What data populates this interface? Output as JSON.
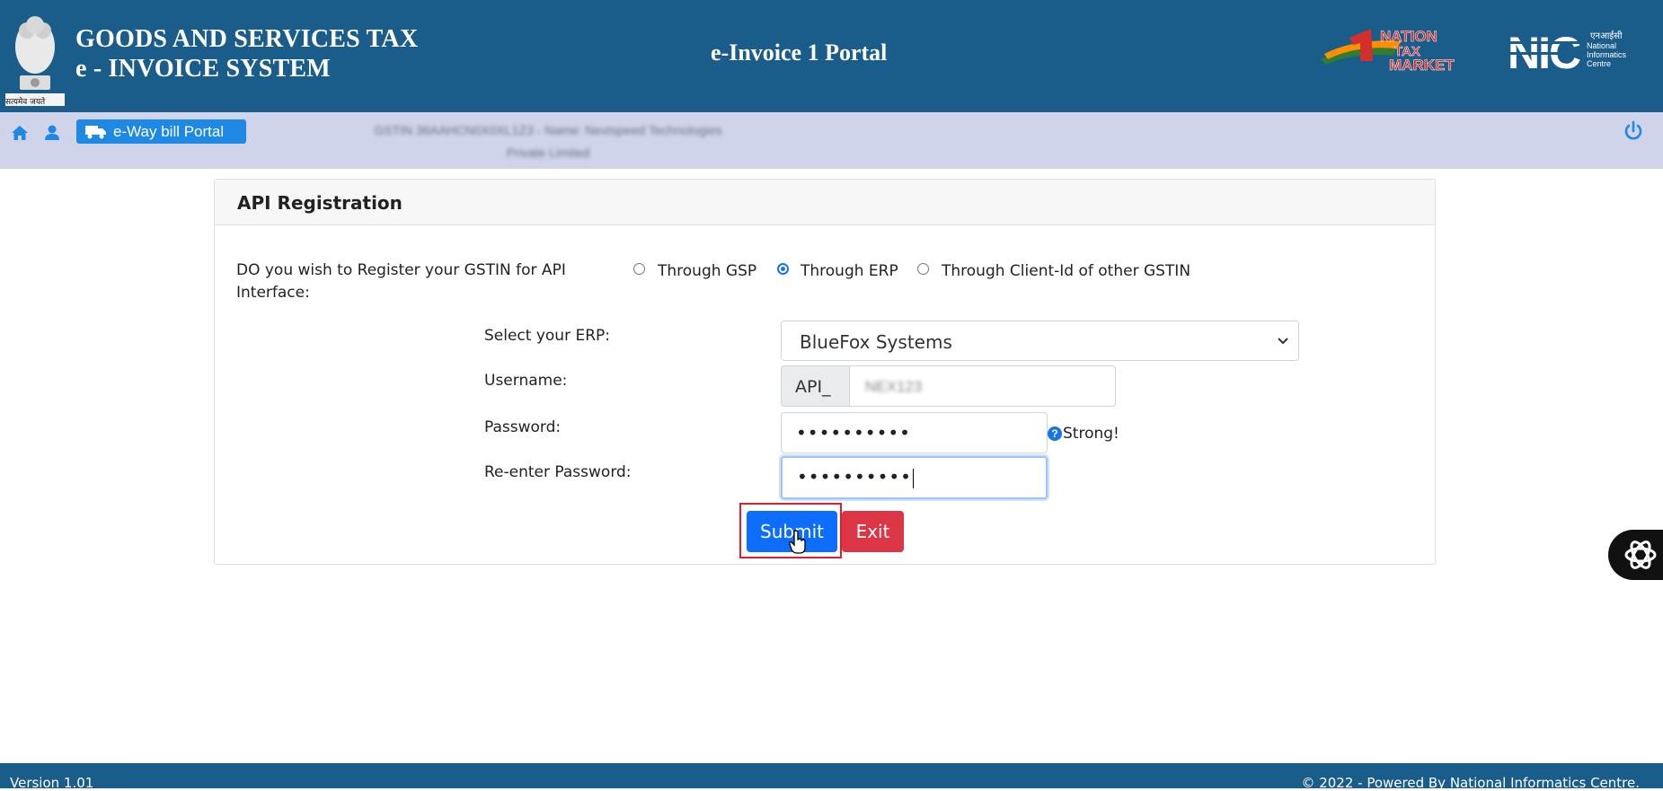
{
  "header": {
    "title_line1": "GOODS AND SERVICES TAX",
    "title_line2": "e - INVOICE SYSTEM",
    "portal_title": "e-Invoice 1 Portal",
    "emblem_motto": "सत्यमेव जयते",
    "nic_hindi": "एनआईसी",
    "nic_sub": [
      "National",
      "Informatics",
      "Centre"
    ],
    "logos": [
      "national-emblem",
      "nation-tax-market-logo",
      "nic-logo"
    ]
  },
  "navbar": {
    "eway_label": "e-Way bill Portal",
    "gstin_line1": "GSTIN 36AAHCN0X0XL1Z3 - Name: Nextspeed Technologies",
    "gstin_line2": "Private Limited",
    "icons": [
      "home-icon",
      "user-icon",
      "truck-icon",
      "power-icon"
    ]
  },
  "form": {
    "card_title": "API Registration",
    "question": "DO you wish to Register your GSTIN for API Interface:",
    "options": [
      {
        "label": "Through GSP",
        "checked": false
      },
      {
        "label": "Through ERP",
        "checked": true
      },
      {
        "label": "Through Client-Id of other GSTIN",
        "checked": false
      }
    ],
    "erp_label": "Select your ERP:",
    "erp_value": "BlueFox Systems",
    "username_label": "Username:",
    "username_prefix": "API_",
    "username_value": "NEX123",
    "password_label": "Password:",
    "password_value": "••••••••••",
    "password_strength": "Strong!",
    "help_glyph": "?",
    "repassword_label": "Re-enter Password:",
    "repassword_value": "••••••••••",
    "submit_label": "Submit",
    "exit_label": "Exit"
  },
  "footer": {
    "version": "Version 1.01",
    "copyright": "© 2022 - Powered By National Informatics Centre."
  },
  "colors": {
    "header_bg": "#1a5c8a",
    "navbar_bg": "#d0d4ea",
    "primary": "#0d6efd",
    "danger": "#dc3545",
    "eway_btn": "#1e88e5",
    "highlight": "#e02030"
  }
}
